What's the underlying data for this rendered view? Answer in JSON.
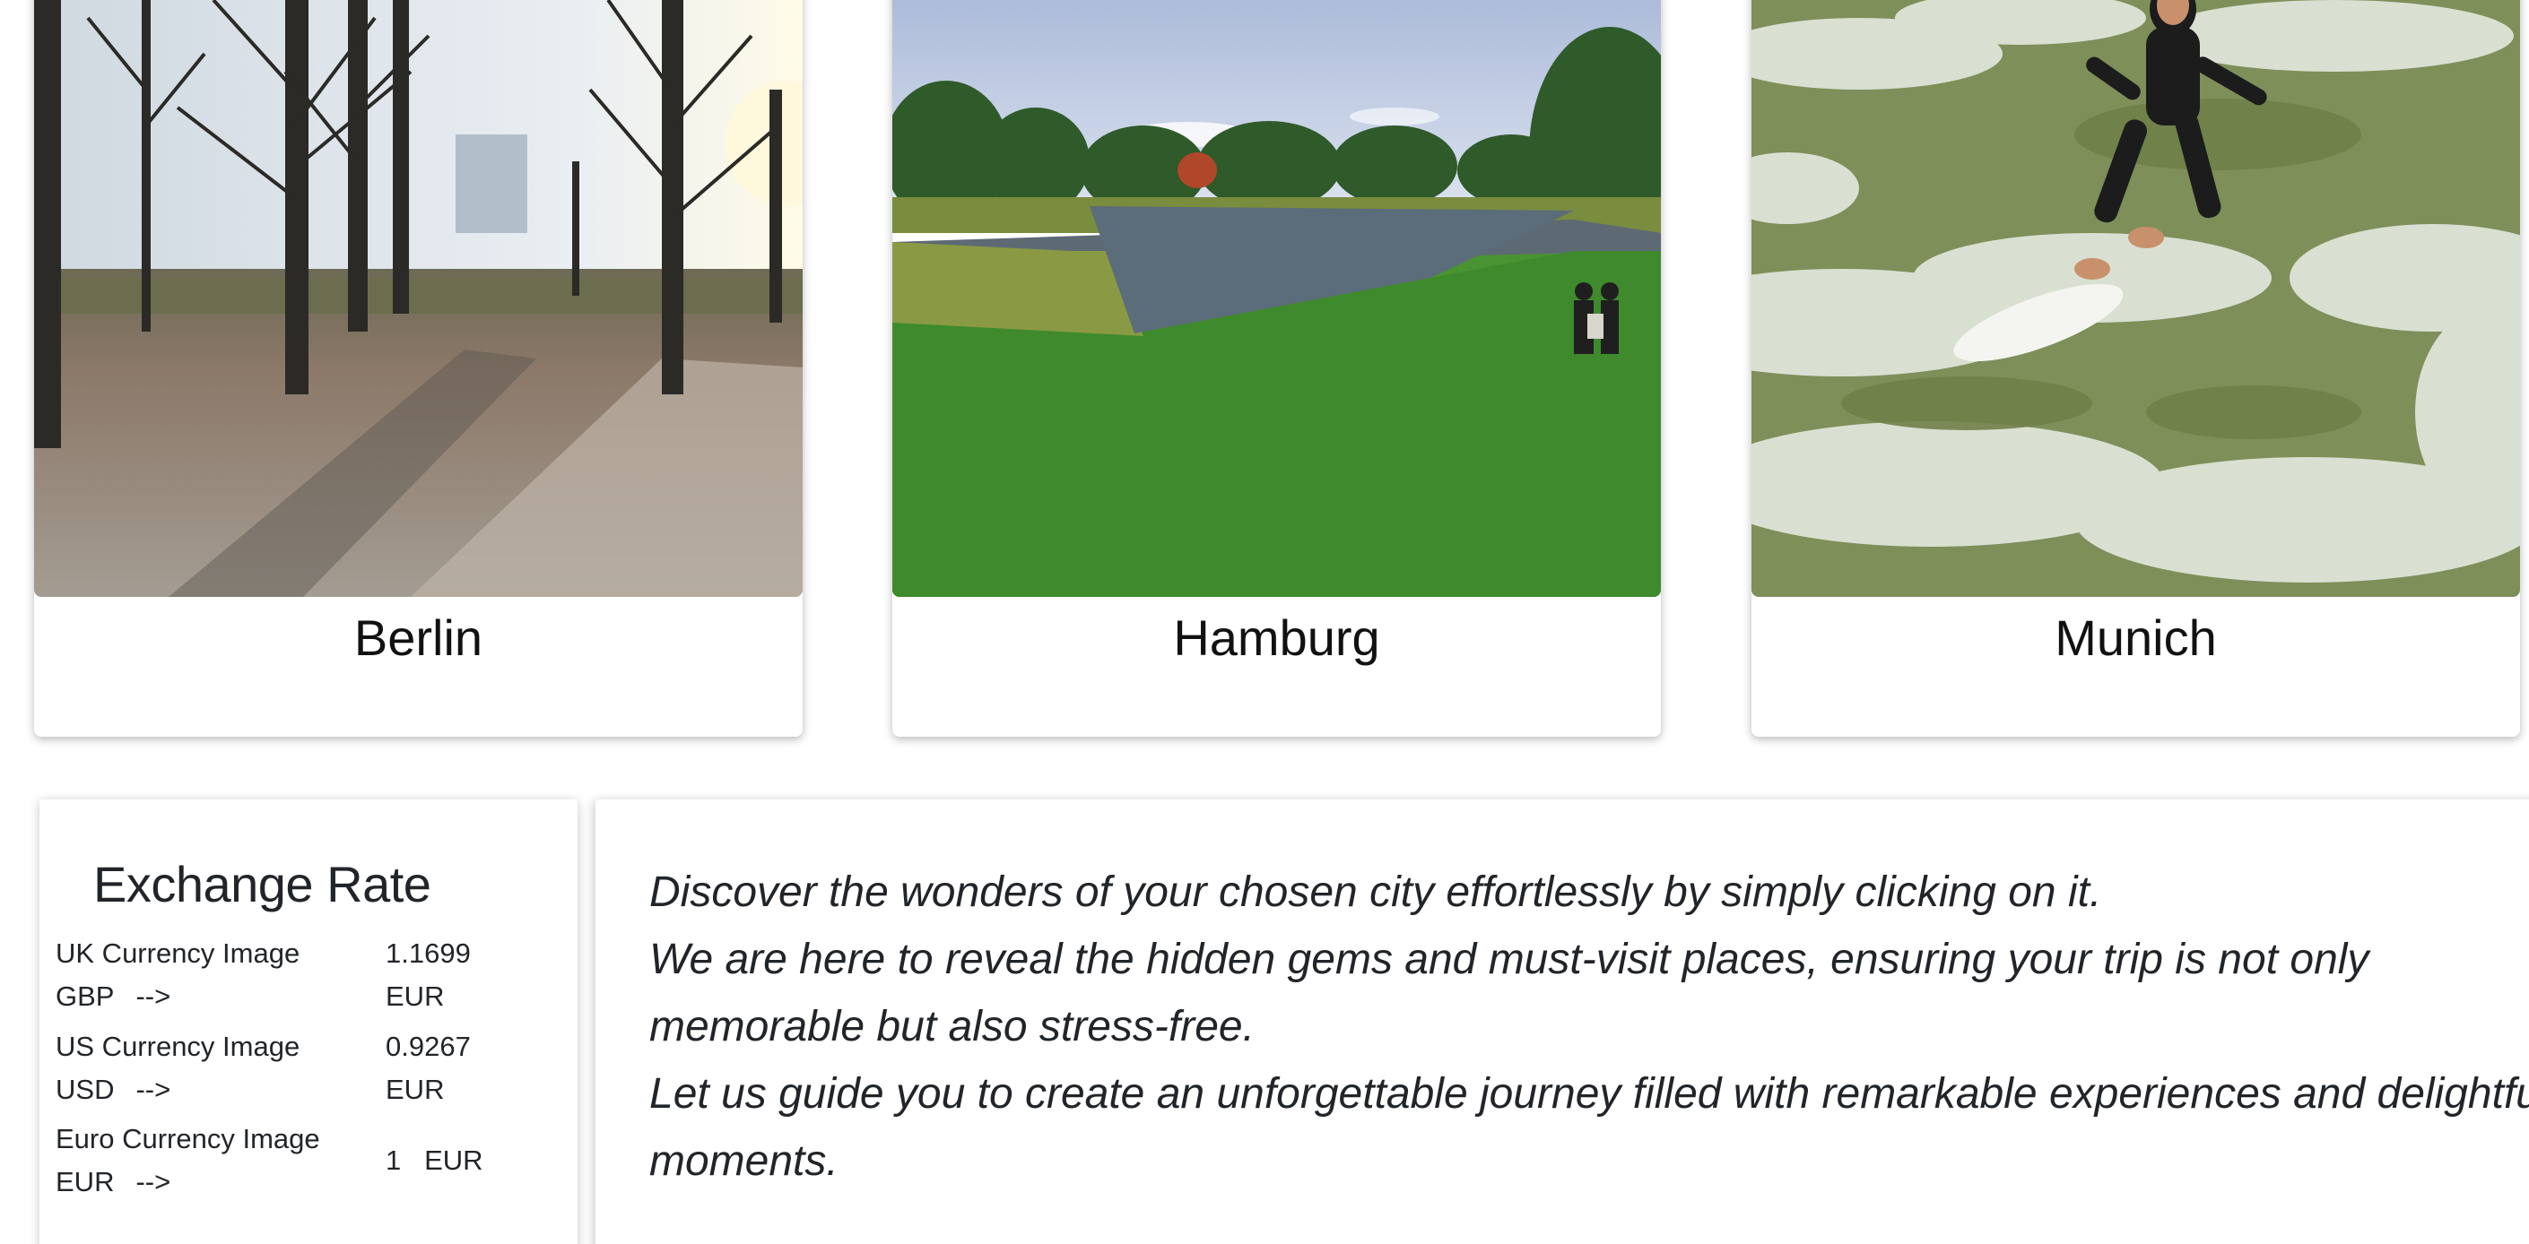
{
  "cities": [
    {
      "name": "Berlin"
    },
    {
      "name": "Hamburg"
    },
    {
      "name": "Munich"
    }
  ],
  "exchange": {
    "title": "Exchange Rate",
    "rows": [
      {
        "image_alt": "UK Currency Image",
        "code": "GBP",
        "arrow": "-->",
        "rate": "1.1699",
        "target": "EUR"
      },
      {
        "image_alt": "US Currency Image",
        "code": "USD",
        "arrow": "-->",
        "rate": "0.9267",
        "target": "EUR"
      },
      {
        "image_alt": "Euro Currency Image",
        "code": "EUR",
        "arrow": "-->",
        "rate": "1",
        "target": "EUR"
      }
    ]
  },
  "intro": {
    "lines": [
      "Discover the wonders of your chosen city effortlessly by simply clicking on it.",
      "We are here to reveal the hidden gems and must-visit places, ensuring your trip is not only memorable but also stress-free.",
      "Let us guide you to create an unforgettable journey filled with remarkable experiences and delightful moments."
    ]
  }
}
